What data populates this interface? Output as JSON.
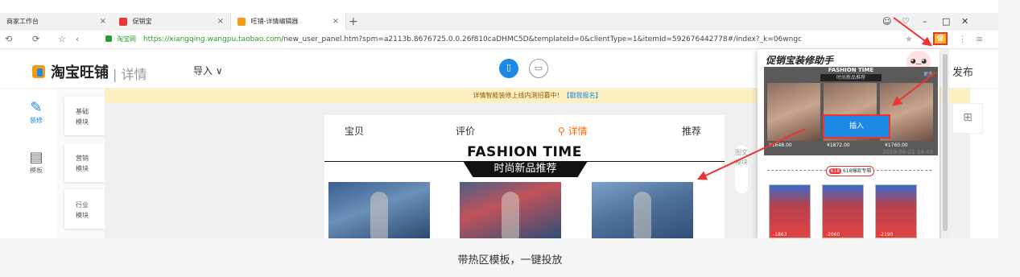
{
  "browser": {
    "tabs": [
      {
        "label": "商家工作台",
        "close": "×"
      },
      {
        "label": "促销宝",
        "close": "×"
      },
      {
        "label": "旺铺-详情编辑器",
        "close": "×"
      }
    ],
    "new_tab": "+",
    "secure_label": "淘宝网",
    "url_host": "https://xiangqing.wangpu.taobao.com",
    "url_path": "/new_user_panel.htm?spm=a2113b.8676725.0.0.26f810caDHMC5D&templateId=0&clientType=1&itemId=592676442778#/index?_k=06wngc"
  },
  "app": {
    "brand": "淘宝旺铺",
    "section": "详情",
    "import_label": "导入 ∨",
    "publish_label": "发布",
    "notice_text": "详情智能装修上线内测招募中！",
    "notice_link": "【戳我报名】"
  },
  "left_rail": [
    {
      "label": "装修",
      "icon": "brush-icon"
    },
    {
      "label": "模板",
      "icon": "template-icon"
    }
  ],
  "modules": [
    "基础\n模块",
    "营销\n模块",
    "行业\n模块"
  ],
  "phone": {
    "tabs": [
      "宝贝",
      "评价",
      "详情",
      "推荐"
    ],
    "heading": "FASHION TIME",
    "banner": "时尚新品推荐"
  },
  "vertical_label": "图文模块",
  "popup": {
    "title": "促销宝装修助手",
    "tpl_title": "FASHION TIME",
    "tpl_sub": "时尚新品推荐",
    "tpl_more": "更多",
    "insert_label": "插入",
    "prices": [
      "¥1648.00",
      "¥1872.00",
      "¥1760.00"
    ],
    "date": "2019-06-21 14:49",
    "tag": "618",
    "tag_text": "618爆款专辑",
    "product_prices": [
      "-1863",
      "-2060",
      "-2190"
    ]
  },
  "caption": "带热区模板，一键投放"
}
